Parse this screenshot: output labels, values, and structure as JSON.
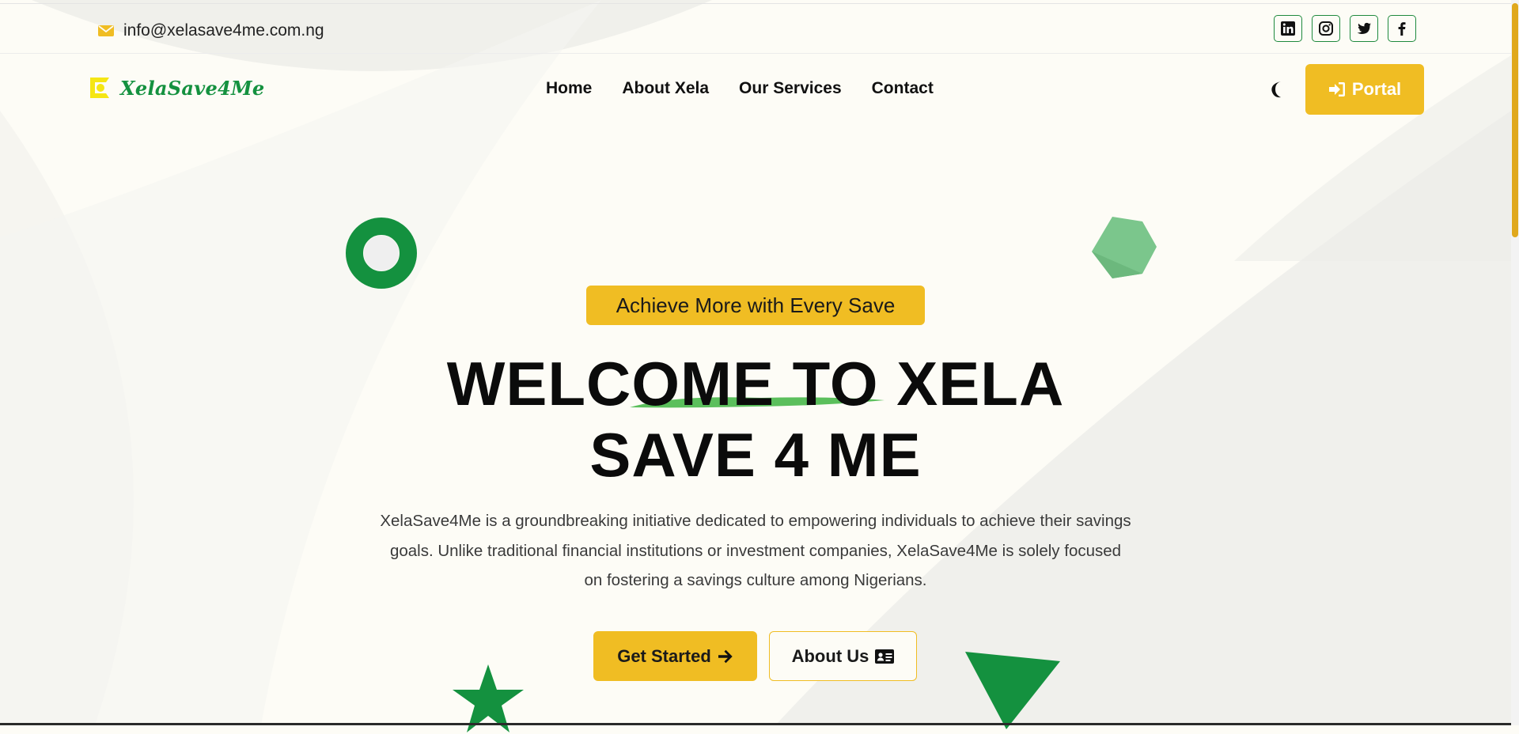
{
  "colors": {
    "accent_yellow": "#f0bd23",
    "brand_green": "#14913f",
    "background": "#fdfcf6",
    "text_dark": "#0b0b0b"
  },
  "topbar": {
    "email": "info@xelasave4me.com.ng",
    "email_icon": "envelope-icon",
    "socials": [
      {
        "name": "linkedin",
        "icon": "linkedin-icon"
      },
      {
        "name": "instagram",
        "icon": "instagram-icon"
      },
      {
        "name": "twitter",
        "icon": "twitter-icon"
      },
      {
        "name": "facebook",
        "icon": "facebook-icon"
      }
    ]
  },
  "navbar": {
    "logo_text": "XelaSave4Me",
    "links": [
      "Home",
      "About Xela",
      "Our Services",
      "Contact"
    ],
    "theme_icon": "moon-icon",
    "portal_label": "Portal",
    "portal_icon": "sign-in-icon"
  },
  "hero": {
    "tagline": "Achieve More with Every Save",
    "headline_line1": "WELCOME TO XELA",
    "headline_line2": "SAVE 4 ME",
    "description": "XelaSave4Me is a groundbreaking initiative dedicated to empowering individuals to achieve their savings goals. Unlike traditional financial institutions or investment companies, XelaSave4Me is solely focused on fostering a savings culture among Nigerians.",
    "primary_button": "Get Started",
    "primary_icon": "arrow-right-icon",
    "secondary_button": "About Us",
    "secondary_icon": "id-card-icon"
  }
}
